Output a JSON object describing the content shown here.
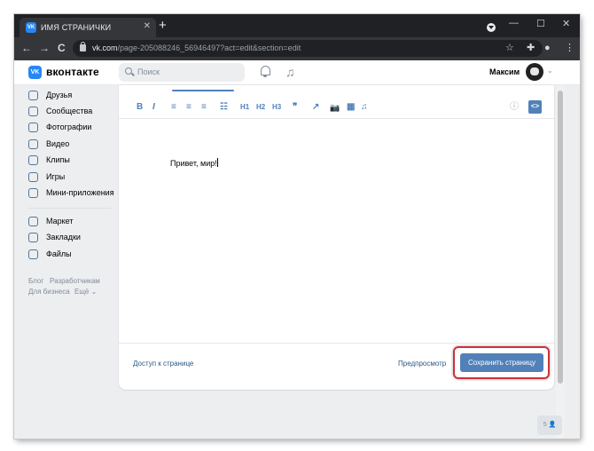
{
  "browser": {
    "tab_title": "ИМЯ СТРАНИЧКИ",
    "tab_favicon": "VK",
    "tab_close": "✕",
    "new_tab": "+",
    "window_controls": {
      "minimize": "—",
      "maximize": "☐",
      "close": "✕"
    },
    "nav": {
      "back": "←",
      "forward": "→",
      "reload": "C"
    },
    "url_host": "vk.com",
    "url_path": "/page-205088246_56946497?act=edit&section=edit",
    "icons": [
      "profile-dot-icon",
      "star-icon",
      "extensions-icon",
      "profile-icon",
      "menu-icon"
    ]
  },
  "vk_header": {
    "logo_text": "вконтакте",
    "logo_mark": "VK",
    "search_placeholder": "Поиск",
    "user_name": "Максим",
    "icons": [
      "bell-icon",
      "music-icon",
      "chevron-down-icon"
    ]
  },
  "sidebar": {
    "items": [
      {
        "label": "Друзья",
        "icon": "friends-icon"
      },
      {
        "label": "Сообщества",
        "icon": "communities-icon"
      },
      {
        "label": "Фотографии",
        "icon": "photos-icon"
      },
      {
        "label": "Видео",
        "icon": "video-icon"
      },
      {
        "label": "Клипы",
        "icon": "clips-icon"
      },
      {
        "label": "Игры",
        "icon": "games-icon"
      },
      {
        "label": "Мини-приложения",
        "icon": "mini-apps-icon"
      }
    ],
    "items2": [
      {
        "label": "Маркет",
        "icon": "market-icon"
      },
      {
        "label": "Закладки",
        "icon": "bookmarks-icon"
      },
      {
        "label": "Файлы",
        "icon": "files-icon"
      }
    ],
    "footer": {
      "blog": "Блог",
      "developers": "Разработчикам",
      "business": "Для бизнеса",
      "more": "Ещё ⌄"
    }
  },
  "editor": {
    "toolbar": [
      "B",
      "I",
      "≡",
      "≡",
      "≡",
      "☷",
      "H1",
      "H2",
      "H3",
      "❞",
      "↗",
      "📷",
      "▦",
      "♫",
      "ⓘ",
      "<>"
    ],
    "content": "Привет, мир!",
    "access_link": "Доступ к странице",
    "preview_link": "Предпросмотр",
    "save_button": "Сохранить страницу"
  },
  "chat_badge": "5 👤"
}
